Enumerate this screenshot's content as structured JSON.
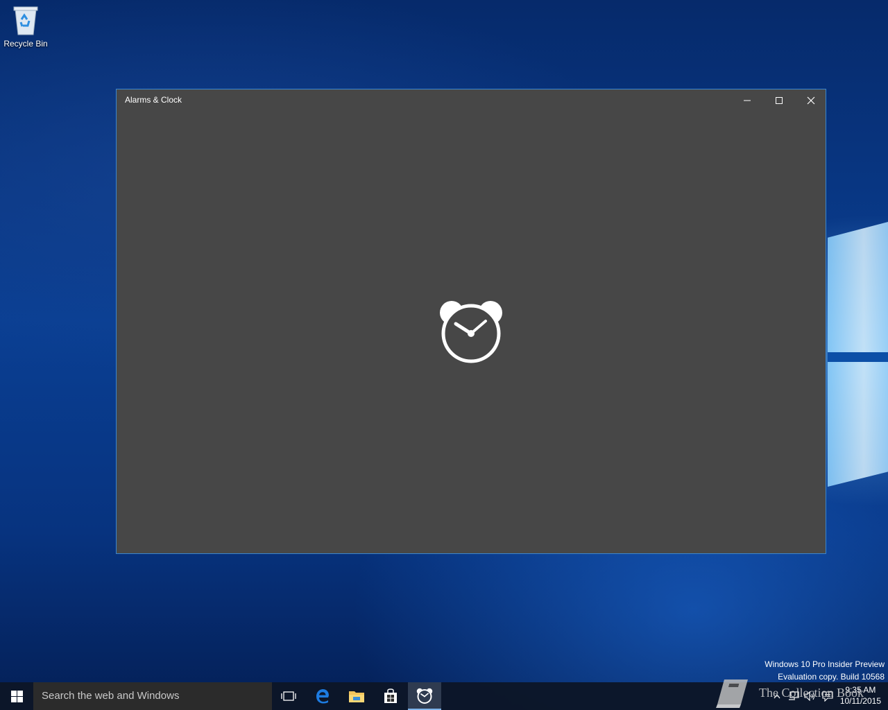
{
  "desktop": {
    "icons": [
      {
        "label": "Recycle Bin",
        "icon": "recycle-bin-icon"
      }
    ],
    "watermark": {
      "line1": "Windows 10 Pro Insider Preview",
      "line2": "Evaluation copy. Build 10568"
    },
    "brand_watermark": "The Collection Book"
  },
  "window": {
    "title": "Alarms & Clock",
    "controls": [
      "minimize-icon",
      "maximize-icon",
      "close-icon"
    ],
    "background_color": "#474747",
    "splash_icon": "alarm-clock-icon"
  },
  "taskbar": {
    "search_placeholder": "Search the web and Windows",
    "pinned": [
      "task-view-icon",
      "edge-icon",
      "file-explorer-icon",
      "store-icon",
      "alarms-clock-icon"
    ],
    "active_app": "Alarms & Clock",
    "tray_icons": [
      "chevron-up-icon",
      "network-icon",
      "volume-icon",
      "action-center-icon"
    ],
    "clock": {
      "time": "9:35 AM",
      "date": "10/11/2015"
    },
    "accent_color": "#7eb4ea"
  }
}
